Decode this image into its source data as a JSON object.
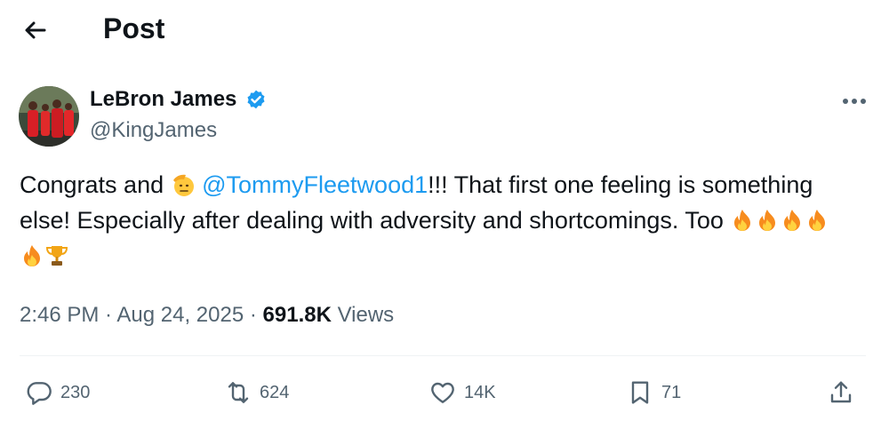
{
  "header": {
    "title": "Post"
  },
  "author": {
    "name": "LeBron James",
    "handle": "@KingJames"
  },
  "tweet": {
    "text_part1": "Congrats and ",
    "mention": "@TommyFleetwood1",
    "text_part2": "!!! That first one feeling  is something else! Especially after dealing with adversity and shortcomings. Too "
  },
  "meta": {
    "time": "2:46 PM",
    "separator": " · ",
    "date": "Aug 24, 2025",
    "views_count": "691.8K",
    "views_label": "Views"
  },
  "actions": {
    "replies": "230",
    "reposts": "624",
    "likes": "14K",
    "bookmarks": "71"
  },
  "colors": {
    "accent": "#1d9bf0",
    "text": "#0f1419",
    "muted": "#536471"
  }
}
